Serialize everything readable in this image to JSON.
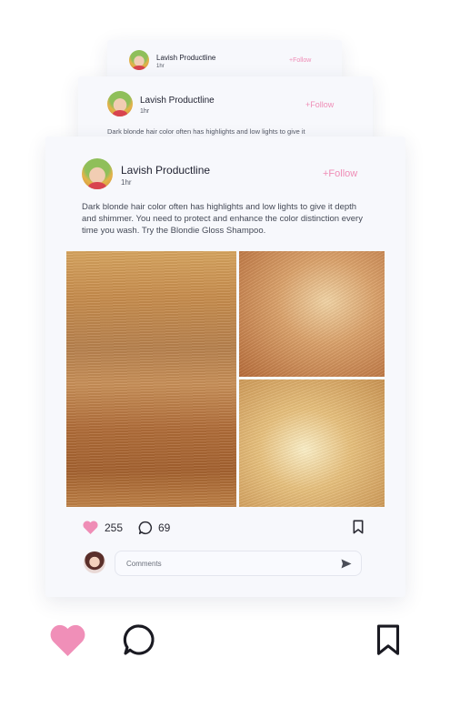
{
  "posts": {
    "back": {
      "author": "Lavish Productline",
      "time": "1hr",
      "follow": "+Follow"
    },
    "middle": {
      "author": "Lavish Productline",
      "time": "1hr",
      "follow": "+Follow",
      "caption_snippet": "Dark blonde hair color often has highlights and low lights to give it"
    },
    "main": {
      "author": "Lavish Productline",
      "time": "1hr",
      "follow": "+Follow",
      "caption": "Dark blonde hair color often has highlights and low lights to give it depth and shimmer. You need to protect and enhance the color distinction every time you wash. Try the Blondie Gloss Shampoo.",
      "likes": "255",
      "comments": "69",
      "comment_placeholder": "Comments"
    }
  },
  "icons": {
    "like": "heart-icon",
    "comment": "comment-bubble-icon",
    "bookmark": "bookmark-icon",
    "send": "send-icon"
  },
  "colors": {
    "accent": "#ef8db6",
    "heart": "#ef8db6",
    "text": "#1f2130"
  }
}
